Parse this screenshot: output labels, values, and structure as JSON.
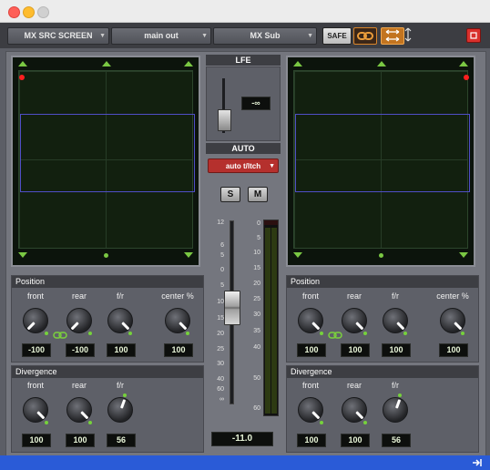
{
  "toolbar": {
    "output": "MX SRC SCREEN",
    "path": "main out",
    "lfe_path": "MX Sub",
    "safe_label": "SAFE",
    "link_icon": "link-icon",
    "panner_mode_icon": "linked-panners-icon",
    "vertical_icon": "vertical-arrows-icon",
    "close_icon": "close-window-icon"
  },
  "left": {
    "position_title": "Position",
    "labels": [
      "front",
      "rear",
      "f/r",
      "center %"
    ],
    "values": [
      "-100",
      "-100",
      "100",
      "100"
    ],
    "divergence_title": "Divergence",
    "div_labels": [
      "front",
      "rear",
      "f/r"
    ],
    "div_values": [
      "100",
      "100",
      "56"
    ]
  },
  "right": {
    "position_title": "Position",
    "labels": [
      "front",
      "rear",
      "f/r",
      "center %"
    ],
    "values": [
      "100",
      "100",
      "100",
      "100"
    ],
    "divergence_title": "Divergence",
    "div_labels": [
      "front",
      "rear",
      "f/r"
    ],
    "div_values": [
      "100",
      "100",
      "56"
    ]
  },
  "center": {
    "lfe_title": "LFE",
    "lfe_value": "-∞",
    "auto_title": "AUTO",
    "auto_mode": "auto t/ltch",
    "solo": "S",
    "mute": "M",
    "fader_scale": [
      "12",
      "6",
      "5",
      "0",
      "5",
      "10",
      "15",
      "20",
      "25",
      "30",
      "40",
      "60",
      "∞"
    ],
    "meter_scale": [
      "0",
      "5",
      "10",
      "15",
      "20",
      "25",
      "30",
      "35",
      "40",
      "50",
      "60"
    ],
    "fader_value": "-11.0"
  },
  "colors": {
    "accent_green": "#76d23b",
    "speaker_green": "#7ac843",
    "auto_red": "#b5302d",
    "close_red": "#d9302c",
    "link_orange": "#d9852a",
    "panner_rect": "#4f4ec7",
    "status_blue": "#2a5bd7"
  }
}
